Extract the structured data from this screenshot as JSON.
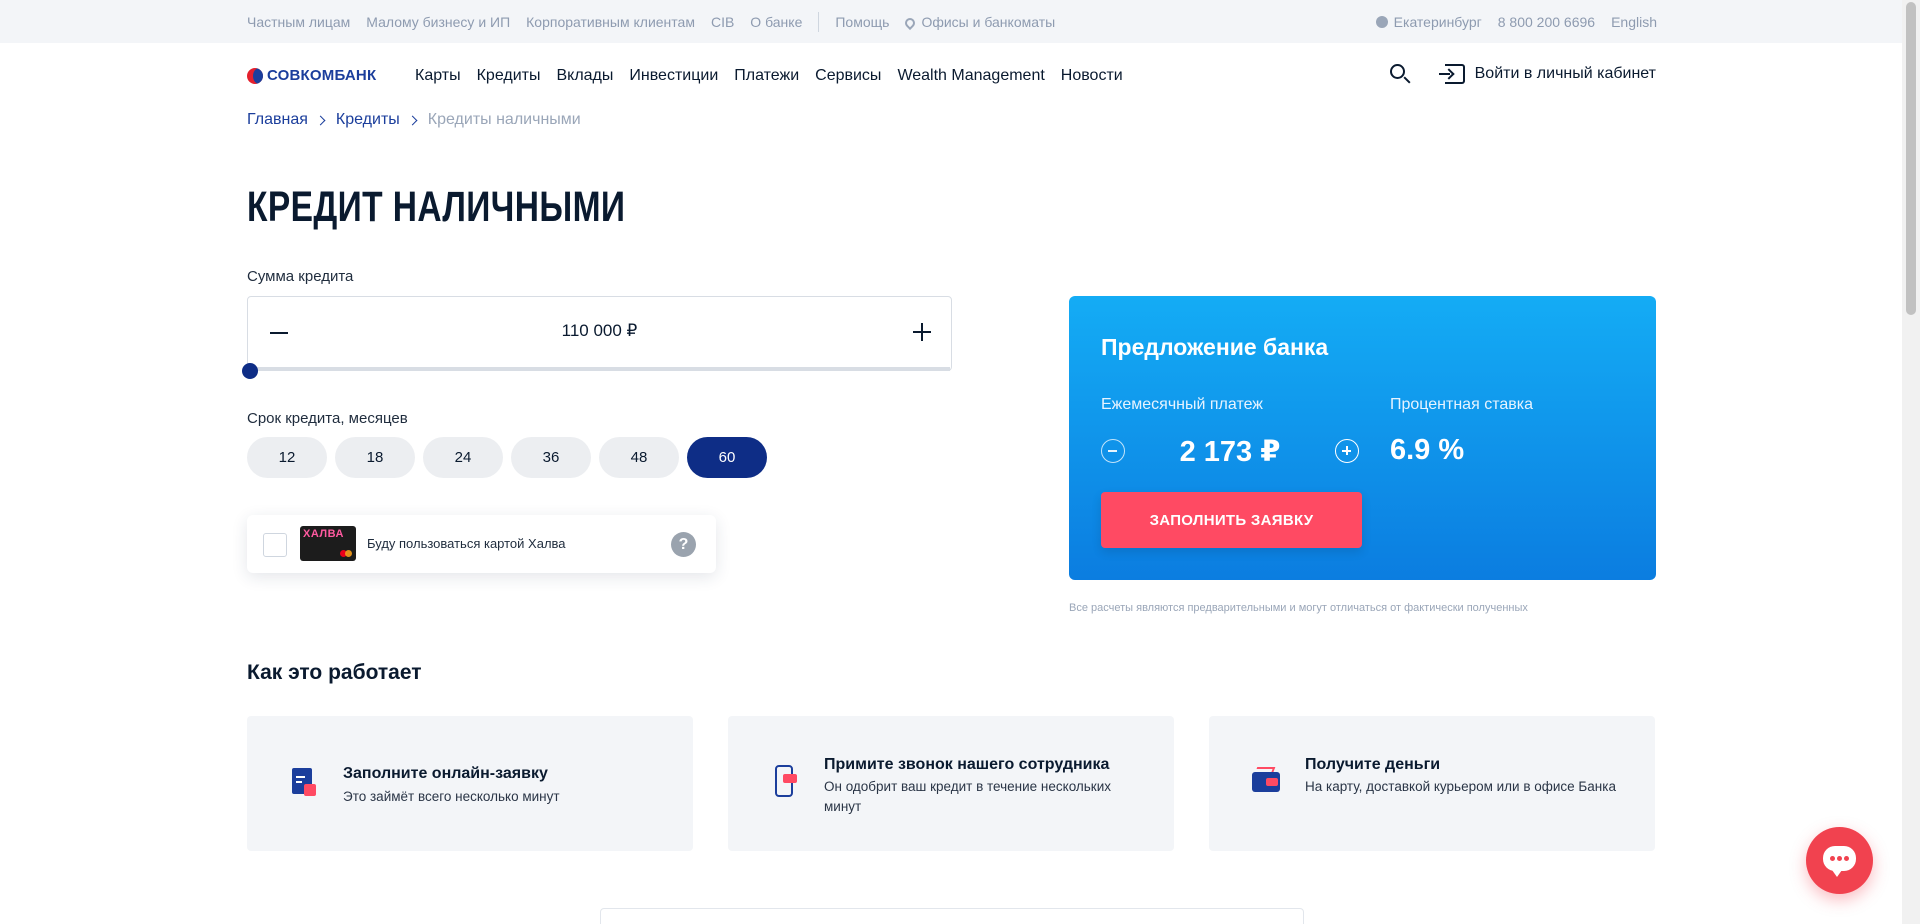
{
  "topbar": {
    "links": [
      "Частным лицам",
      "Малому бизнесу и ИП",
      "Корпоративным клиентам",
      "CIB",
      "О банке"
    ],
    "help": "Помощь",
    "offices": "Офисы и банкоматы",
    "city": "Екатеринбург",
    "phone": "8 800 200 6696",
    "lang": "English"
  },
  "header": {
    "logo": "СОВКОМБАНК",
    "nav": [
      "Карты",
      "Кредиты",
      "Вклады",
      "Инвестиции",
      "Платежи",
      "Сервисы",
      "Wealth Management",
      "Новости"
    ],
    "login": "Войти в личный кабинет"
  },
  "breadcrumb": [
    "Главная",
    "Кредиты",
    "Кредиты наличными"
  ],
  "page_title": "КРЕДИТ НАЛИЧНЫМИ",
  "calculator": {
    "amount_label": "Сумма кредита",
    "amount_value": "110 000 ₽",
    "slider_level": 0,
    "term_label": "Срок кредита, месяцев",
    "terms": [
      "12",
      "18",
      "24",
      "36",
      "48",
      "60"
    ],
    "selected_term": "60",
    "halva_card_brand": "ХАЛВА",
    "halva_text": "Буду пользоваться картой Халва",
    "help_symbol": "?"
  },
  "offer": {
    "title": "Предложение банка",
    "monthly_label": "Ежемесячный платеж",
    "monthly_value": "2 173 ₽",
    "rate_label": "Процентная ставка",
    "rate_value": "6.9 %",
    "apply_button": "ЗАПОЛНИТЬ ЗАЯВКУ",
    "disclaimer": "Все расчеты являются предварительными и могут отличаться от фактически полученных"
  },
  "how_it_works": {
    "title": "Как это работает",
    "steps": [
      {
        "title": "Заполните онлайн-заявку",
        "desc": "Это займёт всего несколько минут",
        "icon": "document-icon"
      },
      {
        "title": "Примите звонок нашего сотрудника",
        "desc": "Он одобрит ваш кредит в течение нескольких минут",
        "icon": "phone-icon"
      },
      {
        "title": "Получите деньги",
        "desc": "На карту, доставкой курьером или в офисе Банка",
        "icon": "wallet-icon"
      }
    ]
  },
  "colors": {
    "brand_blue": "#1b3e9c",
    "active_term": "#0e2d86",
    "apply_red": "#ff4a63",
    "offer_gradient_top": "#14acf5",
    "offer_gradient_bottom": "#0b7de0"
  }
}
